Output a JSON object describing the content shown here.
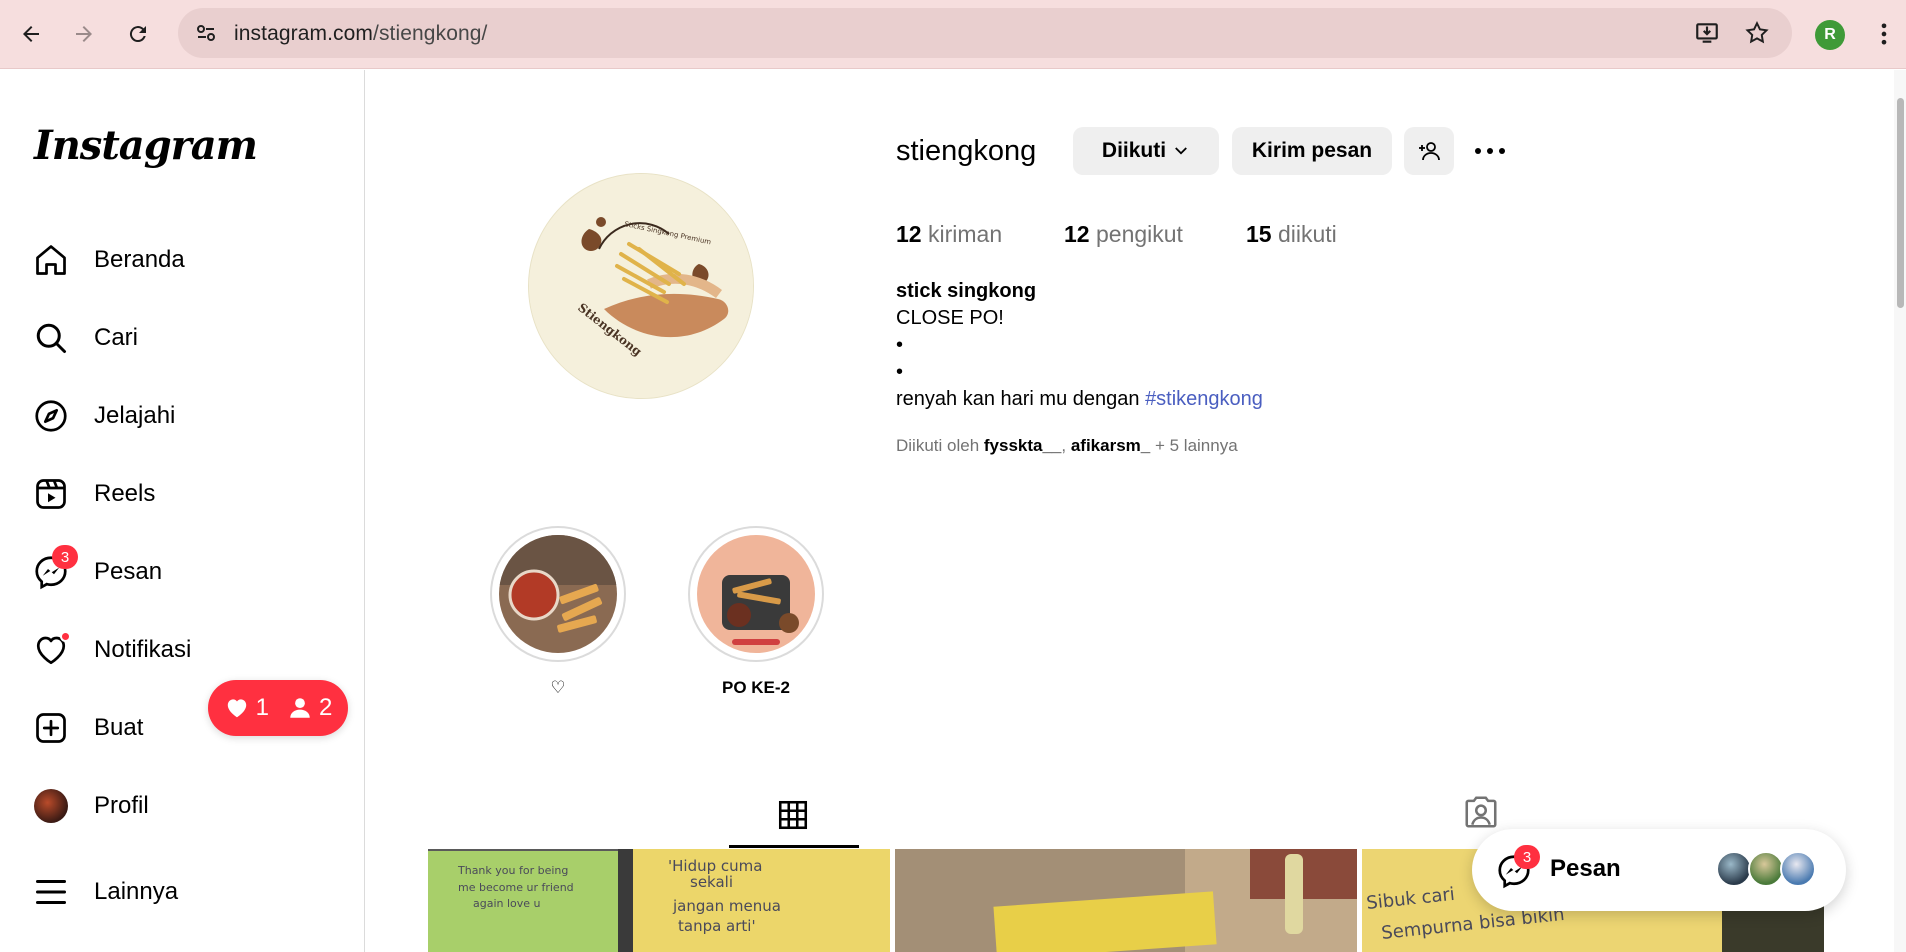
{
  "browser": {
    "url_host": "instagram.com",
    "url_path": "/stiengkong/",
    "profile_initial": "R"
  },
  "sidebar": {
    "logo": "Instagram",
    "items": [
      {
        "label": "Beranda",
        "icon": "home-icon"
      },
      {
        "label": "Cari",
        "icon": "search-icon"
      },
      {
        "label": "Jelajahi",
        "icon": "compass-icon"
      },
      {
        "label": "Reels",
        "icon": "reels-icon"
      },
      {
        "label": "Pesan",
        "icon": "messenger-icon",
        "badge": "3"
      },
      {
        "label": "Notifikasi",
        "icon": "heart-icon"
      },
      {
        "label": "Buat",
        "icon": "plus-square-icon"
      },
      {
        "label": "Profil",
        "icon": "profile-avatar"
      },
      {
        "label": "Lainnya",
        "icon": "menu-icon"
      }
    ],
    "notif_pill": {
      "likes": "1",
      "follows": "2"
    }
  },
  "profile": {
    "username": "stiengkong",
    "following_button": "Diikuti",
    "message_button": "Kirim pesan",
    "stats": {
      "posts_count": "12",
      "posts_label": "kiriman",
      "followers_count": "12",
      "followers_label": "pengikut",
      "following_count": "15",
      "following_label": "diikuti"
    },
    "full_name": "stick singkong",
    "bio": [
      "CLOSE PO!",
      "•",
      "•",
      "renyah kan hari mu dengan "
    ],
    "hashtag": "#stikengkong",
    "followed_by": {
      "prefix": "Diikuti oleh ",
      "user1": "fyssktа__",
      "sep": ", ",
      "user2": "afikarsm_",
      "suffix": " + 5 lainnya"
    },
    "avatar_text": {
      "top": "Sticks Singkong Premium",
      "bottom": "Stiengkong"
    }
  },
  "highlights": [
    {
      "label": "♡"
    },
    {
      "label": "PO KE-2"
    }
  ],
  "posts_preview": [
    {
      "notes": [
        "Thank you for being",
        "me become ur friend",
        "again love u",
        "'Hidup cuma",
        "sekali",
        "jangan menua",
        "tanpa arti'"
      ]
    },
    {
      "notes": []
    },
    {
      "notes": [
        "Sibuk cari",
        "Sempurna bisa bikin"
      ]
    }
  ],
  "messages_float": {
    "label": "Pesan",
    "badge": "3"
  },
  "colors": {
    "accent_red": "#ff3040",
    "link_blue": "#4a5ec0",
    "chrome_pink": "#f6dede"
  }
}
